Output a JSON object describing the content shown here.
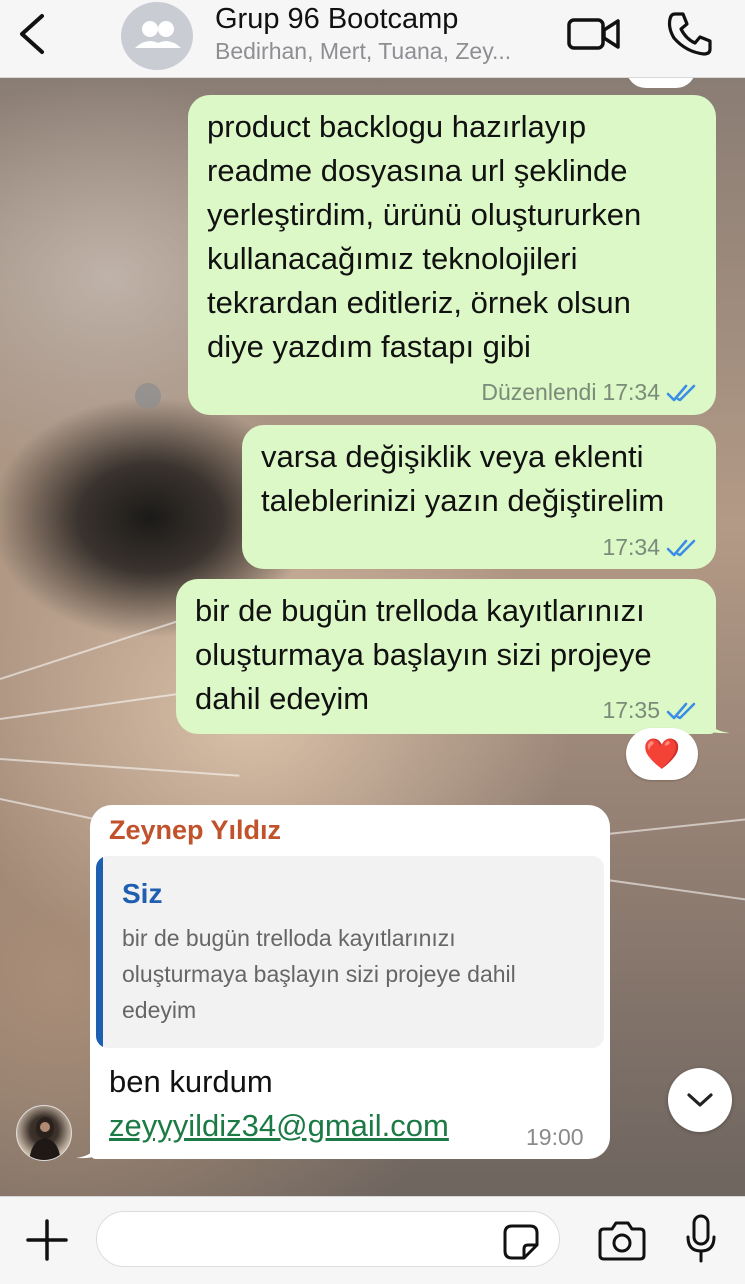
{
  "header": {
    "title": "Grup 96 Bootcamp",
    "subtitle": "Bedirhan, Mert, Tuana, Zey..."
  },
  "messages": [
    {
      "direction": "outgoing",
      "lines": [
        "product backlogu hazırlayıp",
        "readme dosyasına url şeklinde",
        "yerleştirdim, ürünü oluştururken",
        "kullanacağımız teknolojileri",
        "tekrardan editleriz, örnek olsun",
        "diye yazdım fastapı gibi"
      ],
      "edited_label": "Düzenlendi",
      "time": "17:34"
    },
    {
      "direction": "outgoing",
      "lines": [
        "varsa değişiklik veya eklenti",
        "taleblerinizi yazın değiştirelim"
      ],
      "time": "17:34"
    },
    {
      "direction": "outgoing",
      "lines": [
        "bir de bugün trelloda kayıtlarınızı",
        "oluşturmaya başlayın sizi projeye",
        "dahil edeyim"
      ],
      "time": "17:35",
      "reaction": "❤️"
    },
    {
      "direction": "incoming",
      "sender": "Zeynep Yıldız",
      "quote": {
        "author": "Siz",
        "lines": [
          "bir de bugün trelloda kayıtlarınızı",
          "oluşturmaya başlayın sizi projeye dahil",
          "edeyim"
        ]
      },
      "text": "ben kurdum",
      "link": "zeyyyildiz34@gmail.com",
      "time": "19:00"
    }
  ],
  "colors": {
    "outgoing_bubble": "#dcf8c6",
    "incoming_bubble": "#ffffff",
    "sender_name": "#c0532b",
    "quote_accent": "#1f5fb0",
    "read_ticks": "#3a8ee6",
    "link": "#1c7a45"
  },
  "icons": {
    "back": "chevron-left-icon",
    "group": "group-avatar-icon",
    "video": "video-camera-icon",
    "call": "phone-icon",
    "scroll": "chevron-down-icon",
    "plus": "plus-icon",
    "sticker": "sticker-icon",
    "camera": "camera-icon",
    "mic": "microphone-icon"
  }
}
